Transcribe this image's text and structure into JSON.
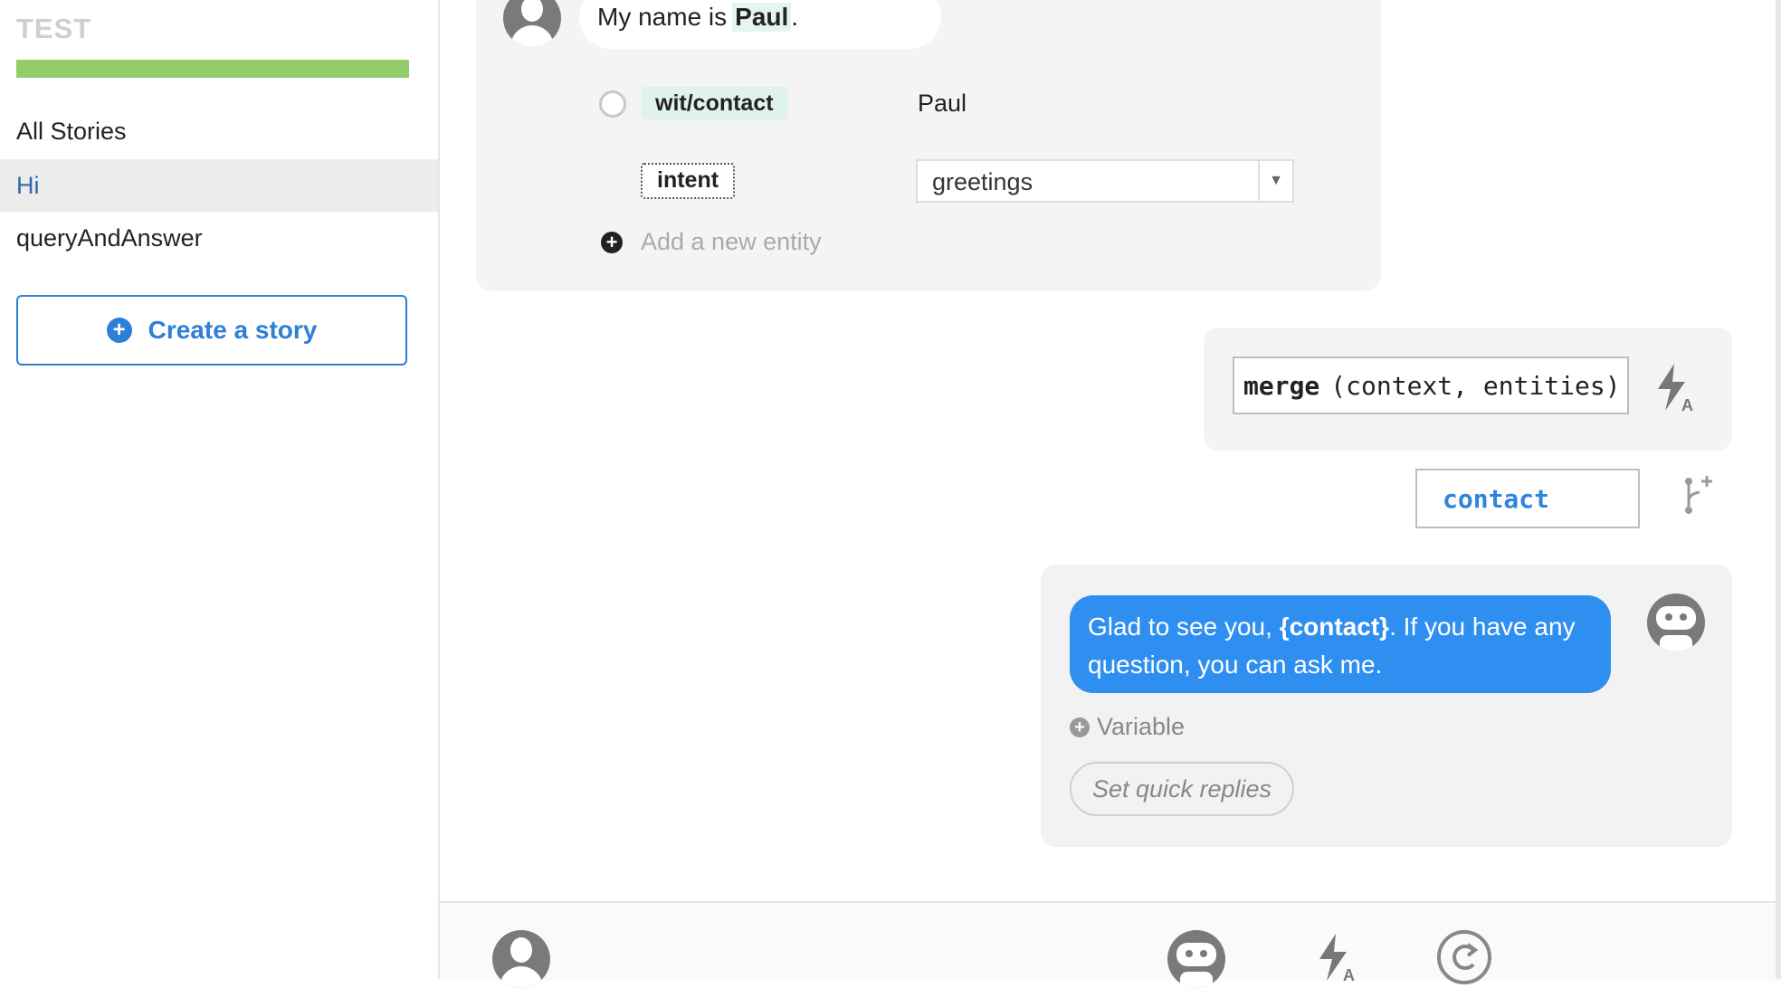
{
  "sidebar": {
    "app_title": "TEST",
    "progress_fraction": 1.0,
    "progress_color": "#94cc6a",
    "all_stories_label": "All Stories",
    "stories": [
      {
        "label": "Hi",
        "active": true
      },
      {
        "label": "queryAndAnswer",
        "active": false
      }
    ],
    "create_story_label": "Create a story"
  },
  "user_turn": {
    "message_prefix": "My name is",
    "message_highlight": "Paul",
    "message_suffix": ".",
    "entities": [
      {
        "name": "wit/contact",
        "value": "Paul"
      },
      {
        "name": "intent",
        "value": "greetings"
      }
    ],
    "add_entity_label": "Add a new entity"
  },
  "action": {
    "function_name": "merge",
    "function_args": "(context, entities)",
    "branch_key": "contact"
  },
  "bot_turn": {
    "text_before": "Glad to see you, ",
    "text_variable": "{contact}",
    "text_after": ". If you have any question, you can ask me.",
    "variable_label": "Variable",
    "quick_replies_placeholder": "Set quick replies"
  },
  "icons": {
    "user_avatar": "user-avatar-icon",
    "bot_avatar": "bot-avatar-icon",
    "action": "lightning-a-icon",
    "branch": "branch-plus-icon",
    "refresh": "refresh-icon"
  },
  "colors": {
    "accent": "#2f7ed8",
    "bot_bubble": "#2f8ff0",
    "entity_highlight": "#dff3ea"
  }
}
